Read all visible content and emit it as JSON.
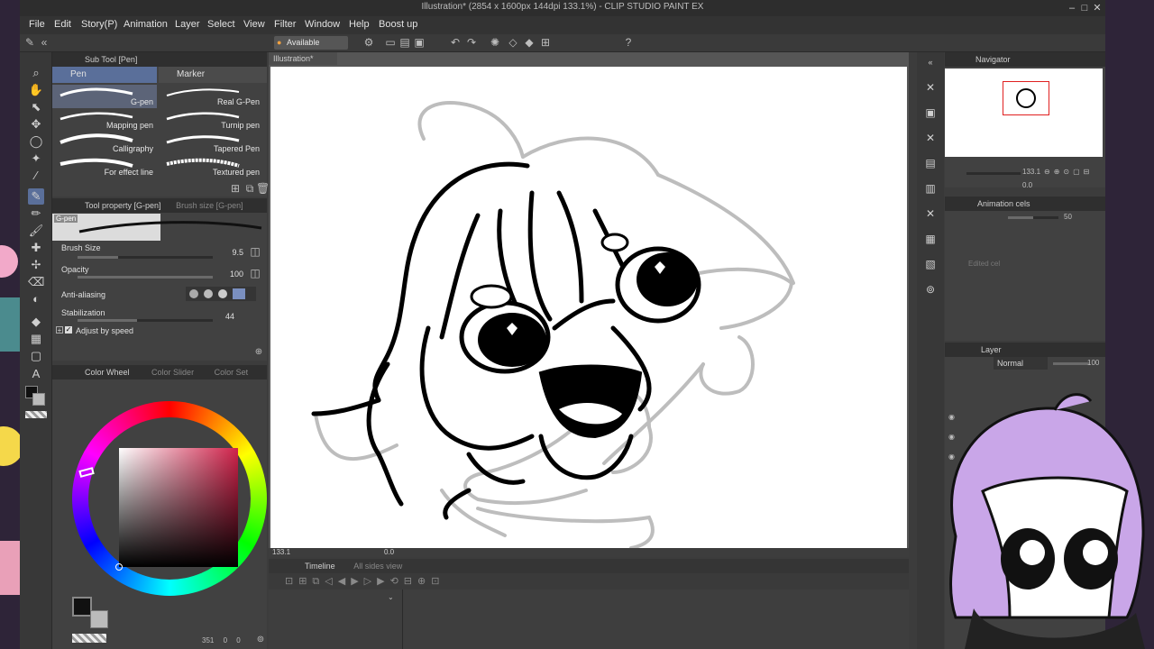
{
  "window": {
    "title": "Illustration* (2854 x 1600px 144dpi 133.1%) - CLIP STUDIO PAINT EX"
  },
  "menu": [
    "File",
    "Edit",
    "Story(P)",
    "Animation",
    "Layer",
    "Select",
    "View",
    "Filter",
    "Window",
    "Help",
    "Boost up"
  ],
  "commandbar": {
    "available_features": "Available features"
  },
  "subtool": {
    "header": "Sub Tool [Pen]",
    "tabs": [
      "Pen",
      "Marker"
    ],
    "brushes": [
      {
        "label": "G-pen"
      },
      {
        "label": "Real G-Pen"
      },
      {
        "label": "Mapping pen"
      },
      {
        "label": "Turnip pen"
      },
      {
        "label": "Calligraphy"
      },
      {
        "label": "Tapered Pen"
      },
      {
        "label": "For effect line"
      },
      {
        "label": "Textured pen"
      }
    ]
  },
  "toolprop": {
    "header": "Tool property [G-pen]",
    "header2": "Brush size [G-pen]",
    "brush_name": "G-pen",
    "brush_size": {
      "label": "Brush Size",
      "value": "9.5",
      "level": 0.3
    },
    "opacity": {
      "label": "Opacity",
      "value": "100",
      "level": 1.0
    },
    "antialiasing": {
      "label": "Anti-aliasing"
    },
    "stabilization": {
      "label": "Stabilization",
      "value": "44",
      "level": 0.44
    },
    "adjust_speed": {
      "label": "Adjust by speed"
    }
  },
  "color": {
    "tabs": [
      "Color Wheel",
      "Color Slider",
      "Color Set"
    ],
    "main_color": "#111111",
    "sub_color": "#bbbbbb",
    "hue_color": "#d0224a",
    "readout": {
      "a": "351",
      "b": "0",
      "c": "0"
    }
  },
  "canvas": {
    "tab": "Illustration*",
    "zoom": "133.1",
    "angle": "0.0"
  },
  "timeline": {
    "tabs": [
      "Timeline",
      "All sides view"
    ]
  },
  "navigator": {
    "header": "Navigator",
    "zoom": "133.1",
    "rotation": "0.0"
  },
  "animation_cels": {
    "header": "Animation cels",
    "opacity": "50",
    "placeholder": "Edited cel"
  },
  "layer": {
    "header": "Layer",
    "blend": "Normal",
    "opacity": "100"
  }
}
